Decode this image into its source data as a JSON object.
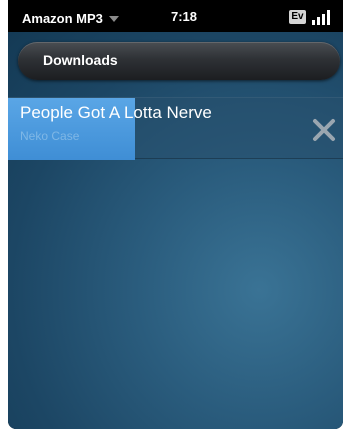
{
  "statusbar": {
    "app_name": "Amazon MP3",
    "time": "7:18",
    "network_badge": "Ev",
    "menu_icon": "chevron-down-icon",
    "signal_icon": "signal-bars-icon"
  },
  "header": {
    "title": "Downloads"
  },
  "downloads": [
    {
      "title": "People Got A Lotta Nerve",
      "artist": "Neko Case",
      "progress": 0.38,
      "cancel_icon": "close-icon"
    }
  ],
  "colors": {
    "progress_fill": "#4b9be0",
    "background": "#2a5c7d",
    "artist_text": "#7fb7e6"
  }
}
